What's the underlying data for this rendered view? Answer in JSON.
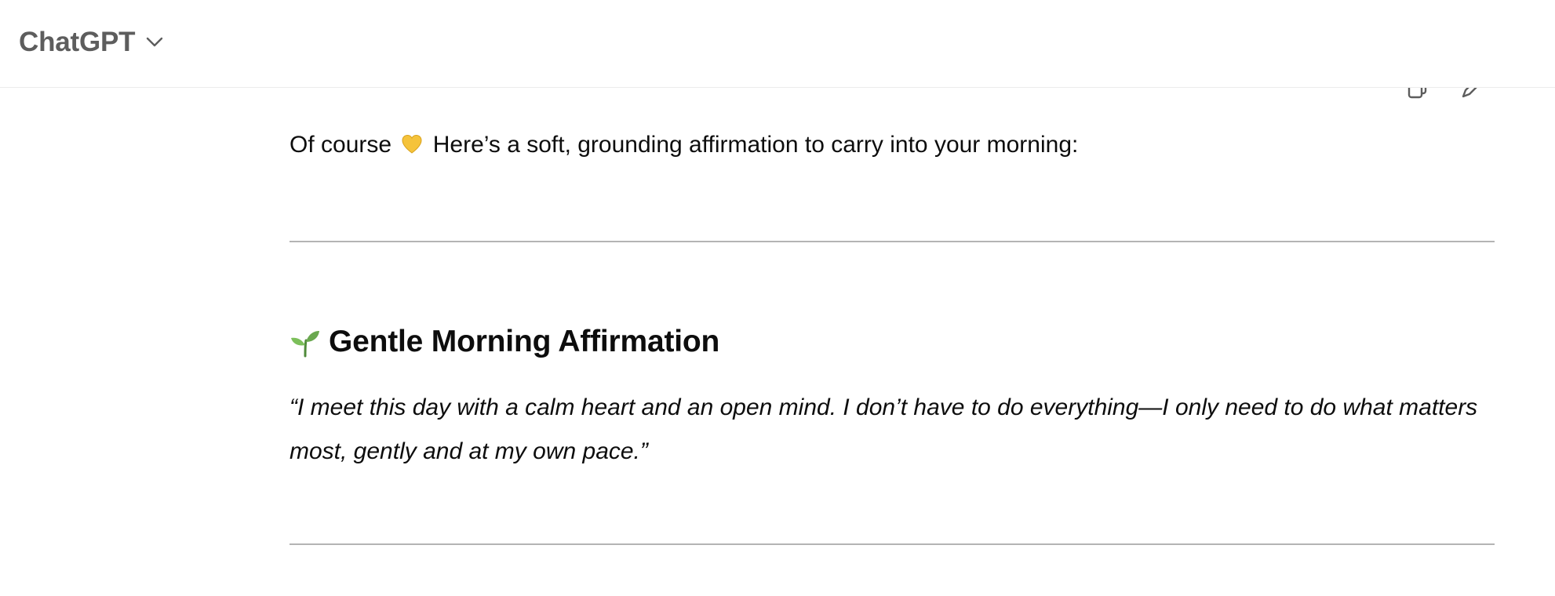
{
  "header": {
    "model_name": "ChatGPT",
    "chevron_icon": "chevron-down-icon"
  },
  "message_actions": {
    "icons": [
      "copy-icon",
      "edit-icon"
    ]
  },
  "message": {
    "intro_before_emoji": "Of course ",
    "intro_emoji": "yellow-heart-icon",
    "intro_after_emoji": " Here’s a soft, grounding affirmation to carry into your morning:",
    "heading_emoji": "seedling-icon",
    "heading": "Gentle Morning Affirmation",
    "quote": "“I meet this day with a calm heart and an open mind. I don’t have to do everything—I only need to do what matters most, gently and at my own pace.”"
  },
  "colors": {
    "header_text": "#5d5d5d",
    "body_text": "#0d0d0d",
    "divider": "#b4b4b4",
    "heart": "#f5c33b",
    "seedling": "#6aa84f"
  }
}
